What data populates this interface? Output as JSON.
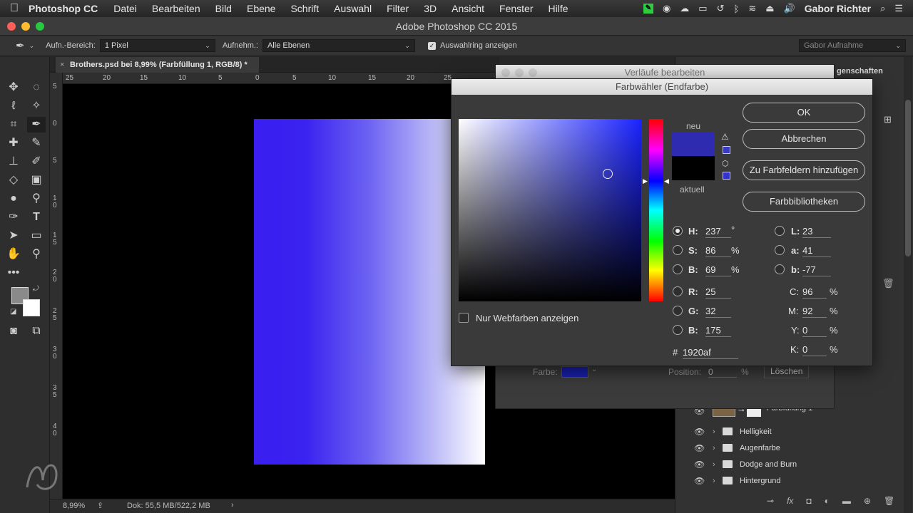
{
  "menubar": {
    "app_name": "Photoshop CC",
    "items": [
      "Datei",
      "Bearbeiten",
      "Bild",
      "Ebene",
      "Schrift",
      "Auswahl",
      "Filter",
      "3D",
      "Ansicht",
      "Fenster",
      "Hilfe"
    ],
    "user": "Gabor Richter"
  },
  "window": {
    "title": "Adobe Photoshop CC 2015"
  },
  "options_bar": {
    "sample_size_label": "Aufn.-Bereich:",
    "sample_size_value": "1 Pixel",
    "sample_label": "Aufnehm.:",
    "sample_value": "Alle Ebenen",
    "show_ring_label": "Auswahlring anzeigen",
    "show_ring_checked": true,
    "workspace_value": "Gabor Aufnahme"
  },
  "document": {
    "tab_title": "Brothers.psd bei 8,99% (Farbfüllung 1, RGB/8) *",
    "close_glyph": "×",
    "h_ruler_labels": [
      "25",
      "20",
      "15",
      "10",
      "5",
      "0",
      "5",
      "10",
      "15",
      "20",
      "25"
    ],
    "v_ruler_labels": [
      "5",
      "0",
      "5",
      "1 0",
      "1 5",
      "2 0",
      "2 5",
      "3 0",
      "3 5",
      "4 0"
    ]
  },
  "status_bar": {
    "zoom": "8,99%",
    "doc_info": "Dok: 55,5 MB/522,2 MB"
  },
  "gradient_editor": {
    "title": "Verläufe bearbeiten",
    "color_label": "Farbe:",
    "position_label": "Position:",
    "position_value": "0",
    "position_unit": "%",
    "delete_button": "Löschen",
    "swatch_color": "#1920af"
  },
  "color_picker": {
    "title": "Farbwähler (Endfarbe)",
    "new_label": "neu",
    "current_label": "aktuell",
    "new_color": "#2f2bb0",
    "current_color": "#000000",
    "buttons": {
      "ok": "OK",
      "cancel": "Abbrechen",
      "add_swatch": "Zu Farbfeldern hinzufügen",
      "libraries": "Farbbibliotheken"
    },
    "web_only_label": "Nur Webfarben anzeigen",
    "hsb": {
      "h": "237",
      "h_unit": "°",
      "s": "86",
      "s_unit": "%",
      "b": "69",
      "b_unit": "%"
    },
    "rgb": {
      "r": "25",
      "g": "32",
      "b": "175"
    },
    "lab": {
      "l": "23",
      "a": "41",
      "b": "-77"
    },
    "cmyk": {
      "c": "96",
      "m": "92",
      "y": "0",
      "k": "0",
      "unit": "%"
    },
    "hex_label": "#",
    "hex": "1920af",
    "labels": {
      "h": "H:",
      "s": "S:",
      "b": "B:",
      "r": "R:",
      "g": "G:",
      "b2": "B:",
      "l": "L:",
      "a": "a:",
      "lb": "b:",
      "c": "C:",
      "m": "M:",
      "y": "Y:",
      "k": "K:"
    }
  },
  "layers": {
    "panel_tab": "genschaften",
    "items": [
      {
        "name": "Farbfüllung 1"
      },
      {
        "name": "Helligkeit"
      },
      {
        "name": "Augenfarbe"
      },
      {
        "name": "Dodge and Burn"
      },
      {
        "name": "Hintergrund"
      }
    ]
  },
  "gradient_colors": {
    "left": "#3a1ff0",
    "right": "#ffffff"
  }
}
